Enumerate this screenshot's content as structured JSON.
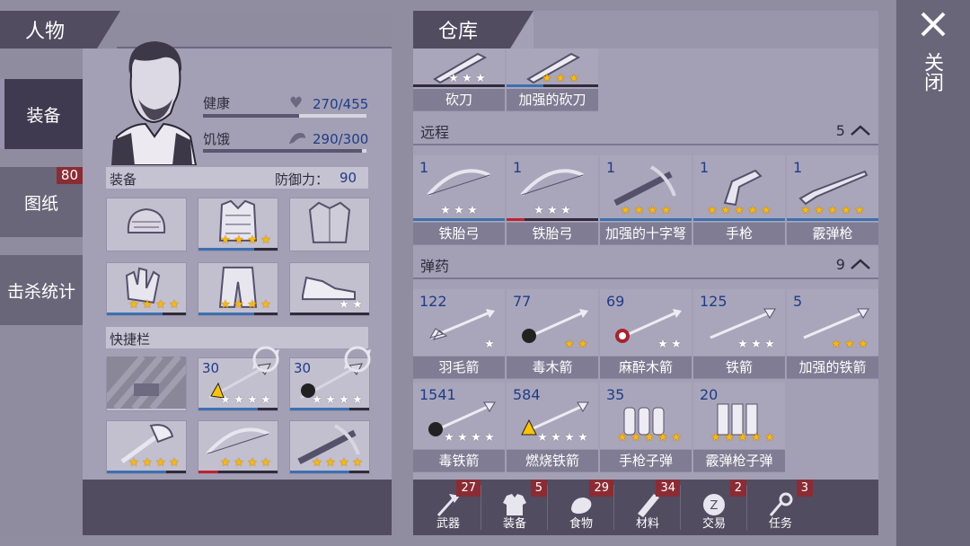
{
  "character": {
    "title": "人物",
    "sidebar": [
      {
        "label": "装备"
      },
      {
        "label": "图纸",
        "badge": "80"
      },
      {
        "label": "击杀统计"
      }
    ],
    "health_label": "健康",
    "health_value": "270/455",
    "health_frac": 0.59,
    "hunger_label": "饥饿",
    "hunger_value": "290/300",
    "hunger_frac": 0.97,
    "equip_label": "装备",
    "defense_label": "防御力：",
    "defense_value": "90",
    "equip_slots": [
      {
        "icon": "cap-icon",
        "stars": 0,
        "gold": false
      },
      {
        "icon": "armor-vest-icon",
        "stars": 4,
        "gold": true
      },
      {
        "icon": "jacket-icon",
        "stars": 0,
        "gold": false
      },
      {
        "icon": "gloves-icon",
        "stars": 4,
        "gold": true
      },
      {
        "icon": "pants-icon",
        "stars": 4,
        "gold": true
      },
      {
        "icon": "shoes-icon",
        "stars": 2,
        "gold": false
      }
    ],
    "quickbar_label": "快捷栏",
    "quickbar": [
      {
        "icon": "locked-slot-icon",
        "count": ""
      },
      {
        "icon": "fire-spear-icon",
        "count": "30",
        "stars": 4,
        "gold": false
      },
      {
        "icon": "poison-spear-icon",
        "count": "30",
        "stars": 4,
        "gold": false
      },
      {
        "icon": "axe-icon",
        "count": "",
        "stars": 4,
        "gold": true
      },
      {
        "icon": "bow-icon",
        "count": "",
        "stars": 4,
        "gold": true
      },
      {
        "icon": "crossbow-icon",
        "count": "",
        "stars": 4,
        "gold": true
      }
    ]
  },
  "warehouse": {
    "title": "仓库",
    "top_items": [
      {
        "name": "砍刀",
        "stars": 3,
        "gold": false
      },
      {
        "name": "加强的砍刀",
        "stars": 3,
        "gold": true
      }
    ],
    "ranged_label": "远程",
    "ranged_count": "5",
    "ranged": [
      {
        "count": "1",
        "name": "铁胎弓",
        "stars": 3,
        "gold": false,
        "icon": "bow-icon"
      },
      {
        "count": "1",
        "name": "铁胎弓",
        "stars": 3,
        "gold": false,
        "icon": "bow-icon"
      },
      {
        "count": "1",
        "name": "加强的十字弩",
        "stars": 4,
        "gold": true,
        "icon": "crossbow-icon"
      },
      {
        "count": "1",
        "name": "手枪",
        "stars": 5,
        "gold": true,
        "icon": "pistol-icon"
      },
      {
        "count": "1",
        "name": "霰弹枪",
        "stars": 5,
        "gold": true,
        "icon": "shotgun-icon"
      }
    ],
    "ammo_label": "弹药",
    "ammo_count": "9",
    "ammo": [
      {
        "count": "122",
        "name": "羽毛箭",
        "stars": 1,
        "gold": false,
        "icon": "feather-arrow-icon"
      },
      {
        "count": "77",
        "name": "毒木箭",
        "stars": 2,
        "gold": true,
        "icon": "poison-arrow-icon"
      },
      {
        "count": "69",
        "name": "麻醉木箭",
        "stars": 2,
        "gold": false,
        "icon": "tranq-arrow-icon"
      },
      {
        "count": "125",
        "name": "铁箭",
        "stars": 3,
        "gold": false,
        "icon": "iron-arrow-icon"
      },
      {
        "count": "5",
        "name": "加强的铁箭",
        "stars": 3,
        "gold": true,
        "icon": "iron-arrow-icon"
      },
      {
        "count": "1541",
        "name": "毒铁箭",
        "stars": 4,
        "gold": false,
        "icon": "poison-iron-arrow-icon"
      },
      {
        "count": "584",
        "name": "燃烧铁箭",
        "stars": 4,
        "gold": false,
        "icon": "fire-iron-arrow-icon"
      },
      {
        "count": "35",
        "name": "手枪子弹",
        "stars": 5,
        "gold": true,
        "icon": "pistol-bullets-icon"
      },
      {
        "count": "20",
        "name": "霰弹枪子弹",
        "stars": 5,
        "gold": true,
        "icon": "shotgun-shells-icon"
      }
    ],
    "tabs": [
      {
        "label": "武器",
        "badge": "27",
        "icon": "weapon-tab-icon"
      },
      {
        "label": "装备",
        "badge": "5",
        "icon": "gear-tab-icon"
      },
      {
        "label": "食物",
        "badge": "29",
        "icon": "food-tab-icon"
      },
      {
        "label": "材料",
        "badge": "34",
        "icon": "material-tab-icon"
      },
      {
        "label": "交易",
        "badge": "2",
        "icon": "trade-tab-icon"
      },
      {
        "label": "任务",
        "badge": "3",
        "icon": "quest-tab-icon"
      }
    ]
  },
  "close_label": "关闭",
  "colors": {
    "accent_blue": "#1f3c88",
    "badge_red": "#8b2c34",
    "star_gold": "#ffb800"
  }
}
